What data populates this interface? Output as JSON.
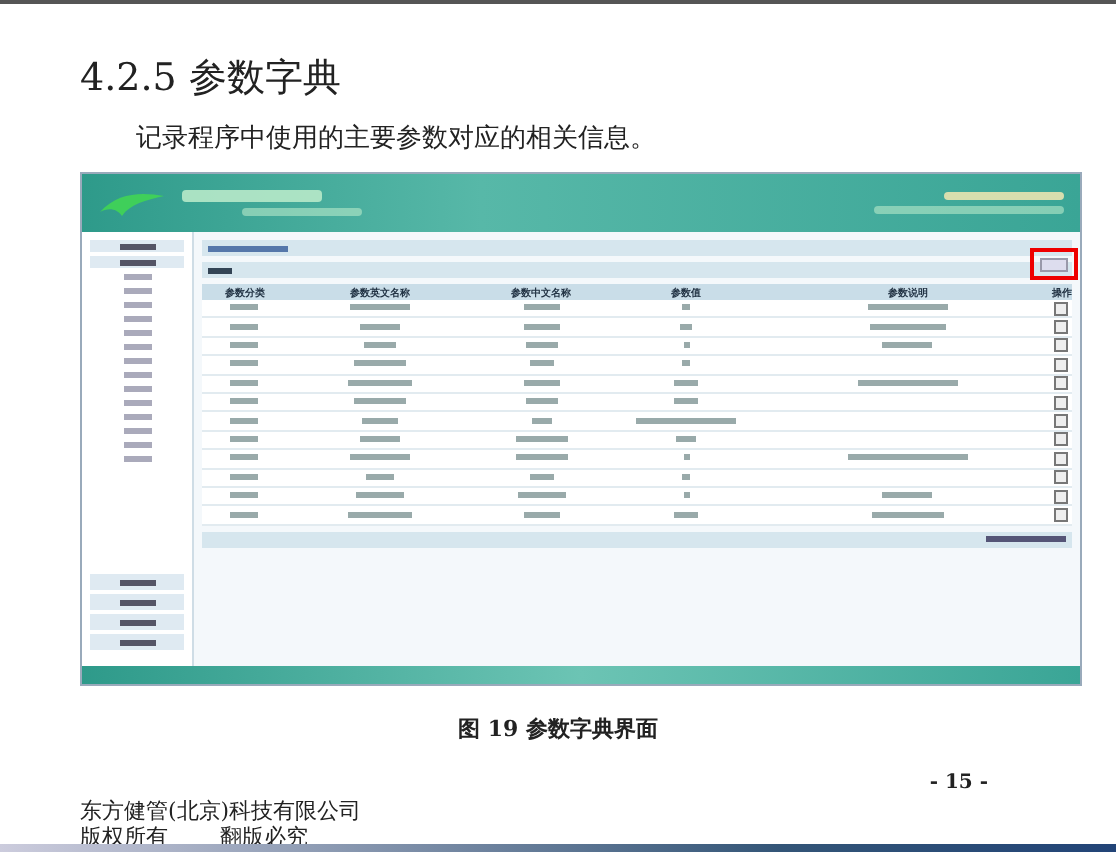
{
  "section_heading": "4.2.5 参数字典",
  "paragraph": "记录程序中使用的主要参数对应的相关信息。",
  "screenshot": {
    "add_button_highlighted": true,
    "table_columns": [
      "参数分类",
      "参数英文名称",
      "参数中文名称",
      "参数值",
      "参数说明",
      "操作"
    ]
  },
  "figure_caption": "图 19 参数字典界面",
  "page_number": "- 15 -",
  "footer": {
    "company": "东方健管(北京)科技有限公司",
    "rights": "版权所有",
    "notice": "翻版必究"
  }
}
